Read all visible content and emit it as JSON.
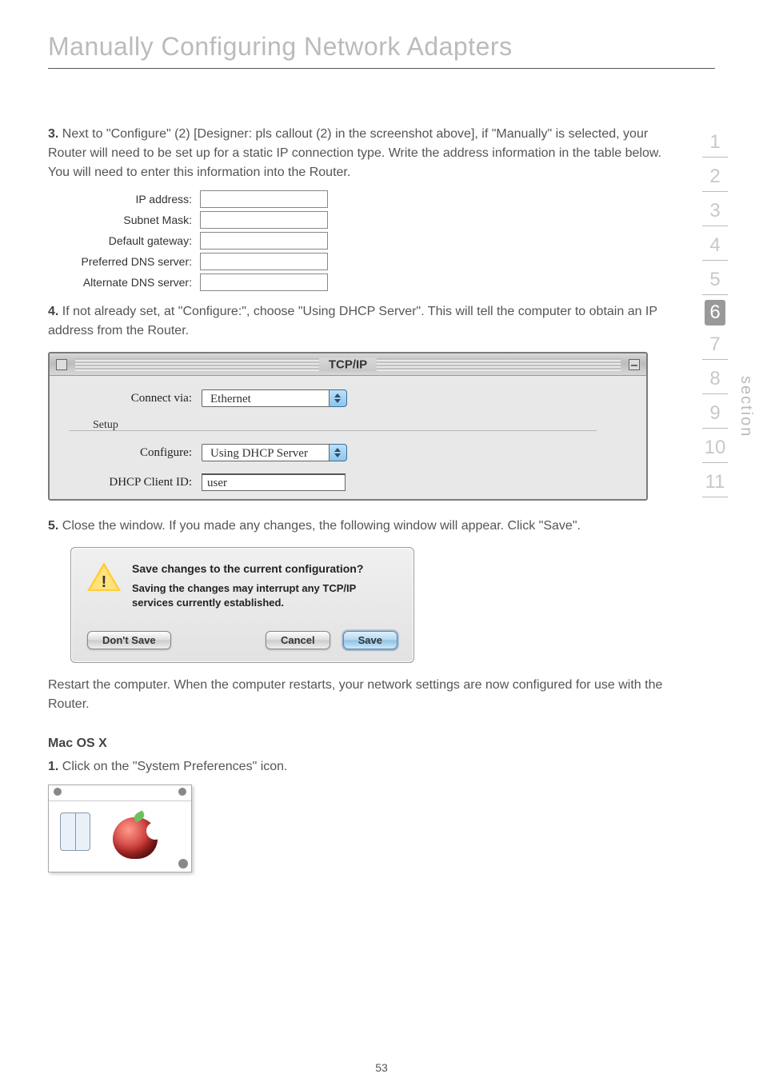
{
  "page_title": "Manually Configuring Network Adapters",
  "section_nav": [
    "1",
    "2",
    "3",
    "4",
    "5",
    "6",
    "7",
    "8",
    "9",
    "10",
    "11"
  ],
  "section_nav_active": 5,
  "section_label": "section",
  "step3_label": "3.",
  "step3_text": " Next to \"Configure\" (2) [Designer: pls callout (2) in the screenshot above], if \"Manually\" is selected, your Router will need to be set up for a static IP connection type. Write the address information in the table below. You will need to enter this information into the Router.",
  "ip_rows": [
    {
      "label": "IP address:"
    },
    {
      "label": "Subnet Mask:"
    },
    {
      "label": "Default gateway:"
    },
    {
      "label": "Preferred DNS server:"
    },
    {
      "label": "Alternate DNS server:"
    }
  ],
  "step4_label": "4.",
  "step4_text": " If not already set, at \"Configure:\", choose \"Using DHCP Server\". This will tell the computer to obtain an IP address from the Router.",
  "tcp_window": {
    "title": "TCP/IP",
    "connect_label": "Connect via:",
    "connect_value": "Ethernet",
    "setup_label": "Setup",
    "configure_label": "Configure:",
    "configure_value": "Using DHCP Server",
    "dhcp_label": "DHCP Client ID:",
    "dhcp_value": "user"
  },
  "step5_label": "5.",
  "step5_text": " Close the window. If you made any changes, the following window will appear. Click \"Save\".",
  "dialog": {
    "heading": "Save changes to the current configuration?",
    "sub": "Saving the changes may interrupt any TCP/IP services currently established.",
    "dont_save": "Don't Save",
    "cancel": "Cancel",
    "save": "Save"
  },
  "restart_text": "Restart the computer. When the computer restarts, your network settings are now configured for use with the Router.",
  "macosx_heading": "Mac OS X",
  "macosx_step1_label": "1.",
  "macosx_step1_text": " Click on the \"System Preferences\" icon.",
  "page_number": "53"
}
